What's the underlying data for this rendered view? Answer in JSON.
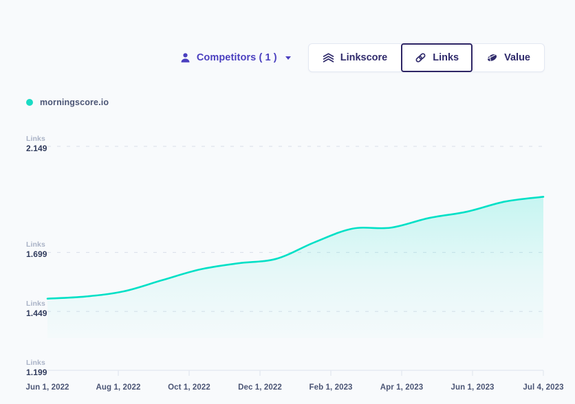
{
  "toolbar": {
    "competitors": {
      "icon": "person-icon",
      "label": "Competitors ( 1 )",
      "caret_icon": "chevron-down-icon"
    },
    "metric_buttons": [
      {
        "label": "Linkscore",
        "icon": "linkscore-icon",
        "active": false
      },
      {
        "label": "Links",
        "icon": "link-chain-icon",
        "active": true
      },
      {
        "label": "Value",
        "icon": "value-coin-icon",
        "active": false
      }
    ]
  },
  "legend": {
    "items": [
      {
        "label": "morningscore.io",
        "color": "#1ADBC4"
      }
    ]
  },
  "colors": {
    "background": "#F8FAFC",
    "series": "#00E0C6",
    "accent": "#4A3FBF",
    "active_border": "#2E2565",
    "text_dark": "#2F3A5C",
    "text_muted": "#A9B2C6",
    "gridline": "#D8DEE9",
    "axis_line": "#E2E7F0"
  },
  "chart_data": {
    "type": "area",
    "title": "",
    "xlabel": "",
    "ylabel": "Links",
    "unit_label": "Links",
    "grid": true,
    "legend_position": "top-left",
    "ylim": [
      1199,
      2149
    ],
    "y_ticks": [
      {
        "unit": "Links",
        "value": "2.149",
        "numeric": 2149
      },
      {
        "unit": "Links",
        "value": "1.699",
        "numeric": 1699
      },
      {
        "unit": "Links",
        "value": "1.449",
        "numeric": 1449
      },
      {
        "unit": "Links",
        "value": "1.199",
        "numeric": 1199
      }
    ],
    "x_ticks": [
      "Jun 1, 2022",
      "Aug 1, 2022",
      "Oct 1, 2022",
      "Dec 1, 2022",
      "Feb 1, 2023",
      "Apr 1, 2023",
      "Jun 1, 2023",
      "Jul 4, 2023"
    ],
    "series": [
      {
        "name": "morningscore.io",
        "color": "#00E0C6",
        "x": [
          "Jun 1, 2022",
          "Jul 1, 2022",
          "Aug 1, 2022",
          "Sep 1, 2022",
          "Oct 1, 2022",
          "Nov 1, 2022",
          "Dec 1, 2022",
          "Jan 1, 2023",
          "Feb 1, 2023",
          "Mar 1, 2023",
          "Apr 1, 2023",
          "May 1, 2023",
          "Jun 1, 2023",
          "Jul 4, 2023"
        ],
        "values": [
          1503,
          1512,
          1534,
          1581,
          1627,
          1653,
          1672,
          1742,
          1800,
          1804,
          1845,
          1872,
          1915,
          1935
        ]
      }
    ]
  }
}
